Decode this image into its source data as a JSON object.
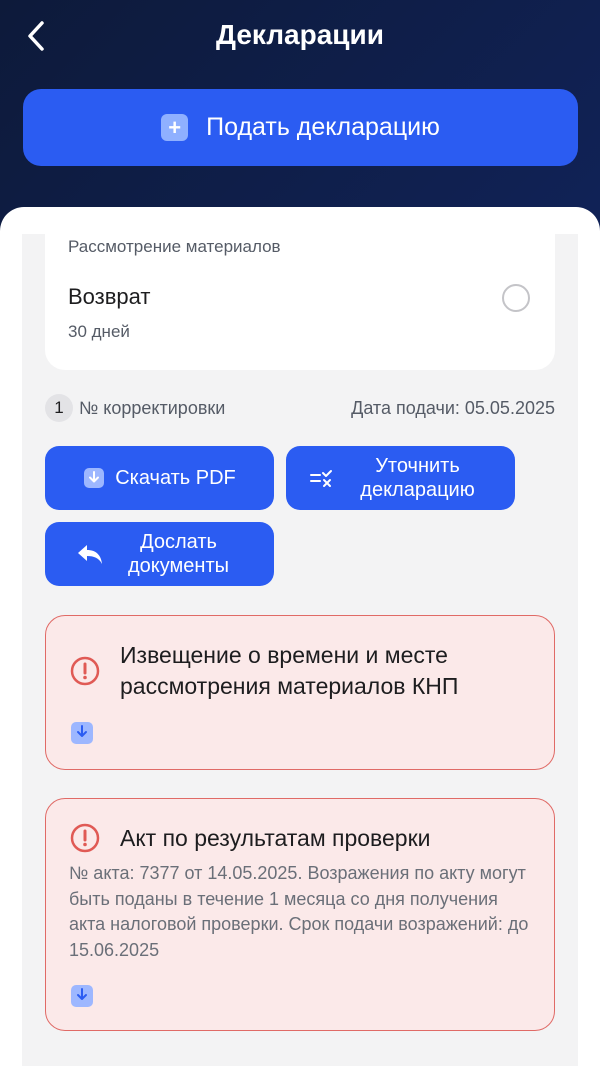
{
  "header": {
    "title": "Декларации",
    "back_icon": "chevron-left-icon",
    "submit_label": "Подать декларацию",
    "submit_icon": "plus-square-icon"
  },
  "status_card": {
    "caption": "Рассмотрение материалов",
    "title": "Возврат",
    "subtitle": "30 дней"
  },
  "meta": {
    "correction_number": "1",
    "correction_label": "№ корректировки",
    "date_label": "Дата подачи: 05.05.2025"
  },
  "actions": {
    "download_pdf": "Скачать PDF",
    "clarify": "Уточнить декларацию",
    "send_docs": "Дослать документы"
  },
  "alerts": [
    {
      "title": "Извещение о времени и месте рассмотрения материалов КНП",
      "body": ""
    },
    {
      "title": "Акт по результатам проверки",
      "body": "№ акта: 7377 от 14.05.2025. Возражения по акту могут быть поданы в течение 1 месяца со дня получения акта налоговой проверки. Срок подачи возражений: до 15.06.2025"
    }
  ],
  "colors": {
    "accent": "#2b5cf2",
    "alert_border": "#e06a66",
    "alert_bg": "#fbe9e9"
  }
}
